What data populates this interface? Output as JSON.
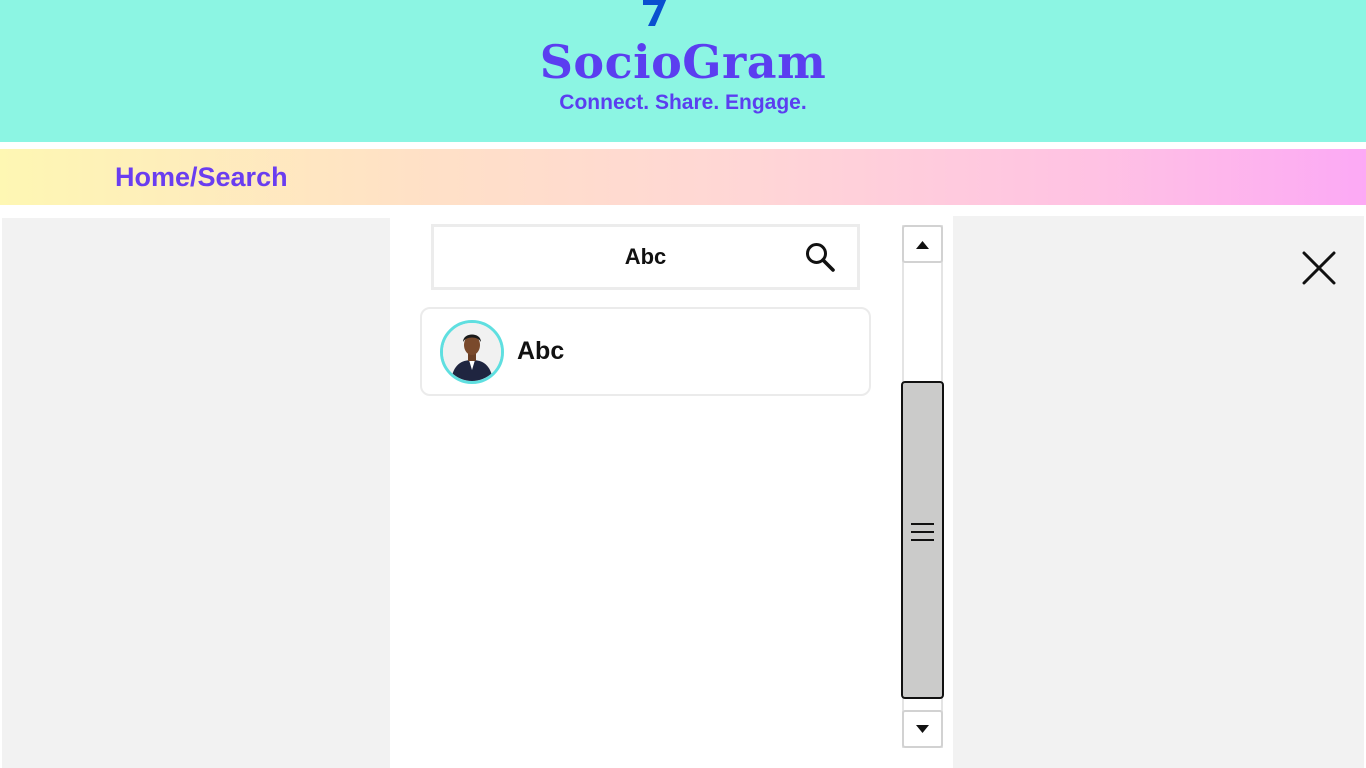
{
  "header": {
    "app_name": "SocioGram",
    "tagline": "Connect. Share. Engage.",
    "logo_icon": "logo-icon",
    "background_color": "#8cf5e3",
    "brand_color": "#5b3ef0"
  },
  "nav": {
    "breadcrumb": "Home/Search"
  },
  "search": {
    "value": "Abc",
    "icon": "search-icon"
  },
  "results": [
    {
      "name": "Abc",
      "avatar": "avatar-photo"
    }
  ],
  "scrollbar": {
    "up_icon": "arrow-up-icon",
    "down_icon": "arrow-down-icon",
    "grip_icon": "grip-lines-icon"
  },
  "panel": {
    "close_icon": "close-icon"
  }
}
